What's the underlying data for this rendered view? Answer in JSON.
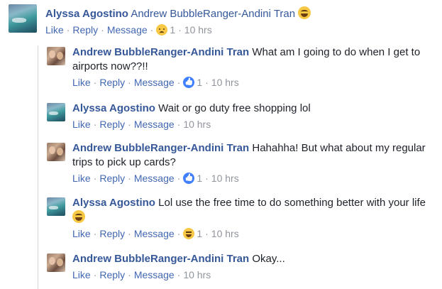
{
  "actions": {
    "like": "Like",
    "reply": "Reply",
    "message": "Message",
    "dot": "·"
  },
  "top_comment": {
    "author": "Alyssa Agostino",
    "mention": "Andrew BubbleRanger-Andini Tran",
    "emoji": "laughing-tears-emoji",
    "reaction": "sad-face-reaction",
    "reaction_count": "1",
    "time": "10 hrs"
  },
  "replies": [
    {
      "author": "Andrew BubbleRanger-Andini Tran",
      "text": "What am I going to do when I get to airports now??!!",
      "reaction": "like-reaction",
      "reaction_count": "1",
      "time": "10 hrs"
    },
    {
      "author": "Alyssa Agostino",
      "text": "Wait or go duty free shopping lol",
      "time": "10 hrs"
    },
    {
      "author": "Andrew BubbleRanger-Andini Tran",
      "text": "Hahahha! But what about my regular trips to pick up cards?",
      "reaction": "like-reaction",
      "reaction_count": "1",
      "time": "10 hrs"
    },
    {
      "author": "Alyssa Agostino",
      "text": "Lol use the free time to do something better with your life",
      "emoji": "laughing-tears-emoji",
      "reaction": "laughing-reaction",
      "reaction_count": "1",
      "time": "10 hrs"
    },
    {
      "author": "Andrew BubbleRanger-Andini Tran",
      "text": "Okay...",
      "time": "10 hrs"
    }
  ],
  "colors": {
    "link": "#365899",
    "action": "#4267b2",
    "meta": "#90949c",
    "thread_line": "#d3d6db"
  }
}
